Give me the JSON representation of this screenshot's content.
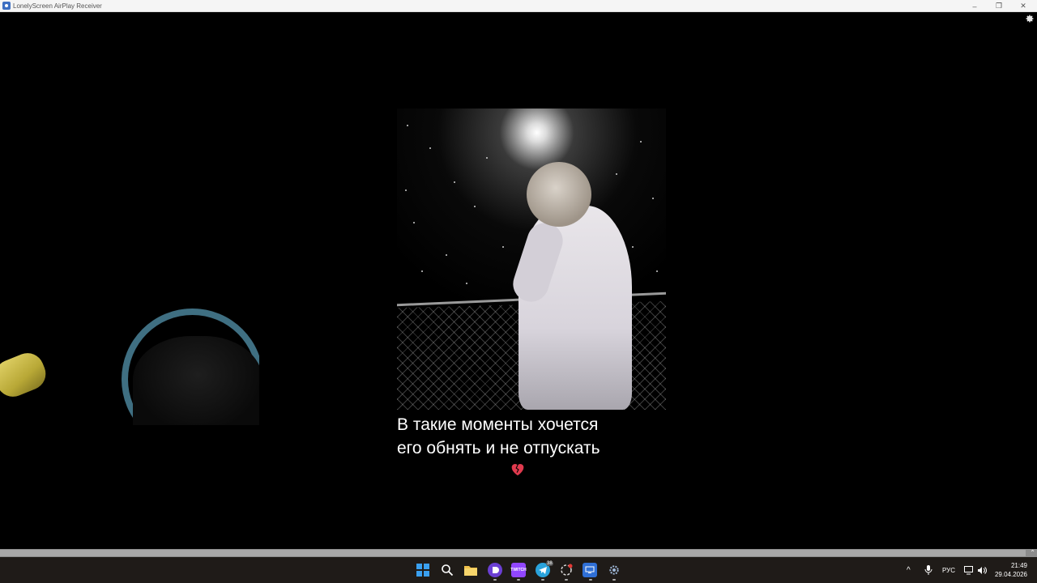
{
  "window": {
    "title": "LonelyScreen AirPlay Receiver",
    "controls": {
      "minimize": "–",
      "maximize": "❐",
      "close": "✕"
    }
  },
  "receiver": {
    "settings_icon": "gear-icon",
    "video": {
      "caption_line1": "В такие моменты хочется",
      "caption_line2": "его обнять и не отпускать",
      "caption_emoji": "broken-heart-icon"
    }
  },
  "scrollbar": {
    "arrow": "⌃"
  },
  "taskbar": {
    "items": [
      {
        "name": "start-icon"
      },
      {
        "name": "search-icon"
      },
      {
        "name": "file-explorer-icon"
      },
      {
        "name": "app-circle-icon"
      },
      {
        "name": "twitch-icon",
        "label": "TWITCH"
      },
      {
        "name": "telegram-icon",
        "badge": "38"
      },
      {
        "name": "app-loop-icon"
      },
      {
        "name": "remote-desktop-icon"
      },
      {
        "name": "settings-icon"
      }
    ],
    "tray": {
      "chevron": "^",
      "language": "РУС"
    },
    "clock": {
      "time": "21:49",
      "date": "29.04.2026"
    }
  },
  "colors": {
    "titlebar": "#f5f5f5",
    "taskbar": "#1f1b18",
    "start": "#3aa0f0",
    "twitch": "#9146ff",
    "heart": "#e03a4e"
  }
}
